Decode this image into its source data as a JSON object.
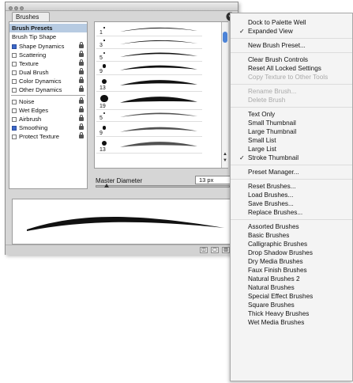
{
  "palette": {
    "tab_label": "Brushes",
    "options": [
      {
        "label": "Brush Presets",
        "selected": true,
        "checkbox": false,
        "checked": false,
        "lock": false
      },
      {
        "label": "Brush Tip Shape",
        "selected": false,
        "checkbox": false,
        "checked": false,
        "lock": false
      },
      {
        "label": "Shape Dynamics",
        "selected": false,
        "checkbox": true,
        "checked": true,
        "lock": true
      },
      {
        "label": "Scattering",
        "selected": false,
        "checkbox": true,
        "checked": false,
        "lock": true
      },
      {
        "label": "Texture",
        "selected": false,
        "checkbox": true,
        "checked": false,
        "lock": true
      },
      {
        "label": "Dual Brush",
        "selected": false,
        "checkbox": true,
        "checked": false,
        "lock": true
      },
      {
        "label": "Color Dynamics",
        "selected": false,
        "checkbox": true,
        "checked": false,
        "lock": true
      },
      {
        "label": "Other Dynamics",
        "selected": false,
        "checkbox": true,
        "checked": false,
        "lock": true
      },
      {
        "label": "Noise",
        "selected": false,
        "checkbox": true,
        "checked": false,
        "lock": true
      },
      {
        "label": "Wet Edges",
        "selected": false,
        "checkbox": true,
        "checked": false,
        "lock": true
      },
      {
        "label": "Airbrush",
        "selected": false,
        "checkbox": true,
        "checked": false,
        "lock": true
      },
      {
        "label": "Smoothing",
        "selected": false,
        "checkbox": true,
        "checked": true,
        "lock": true
      },
      {
        "label": "Protect Texture",
        "selected": false,
        "checkbox": true,
        "checked": false,
        "lock": true
      }
    ],
    "brush_sizes": [
      "1",
      "3",
      "5",
      "9",
      "13",
      "19",
      "5",
      "9",
      "13"
    ],
    "master_diameter_label": "Master Diameter",
    "master_diameter_value": "13 px",
    "master_diameter_slider_level": 0.08
  },
  "menu": {
    "groups": [
      [
        {
          "label": "Dock to Palette Well",
          "checked": false,
          "disabled": false
        },
        {
          "label": "Expanded View",
          "checked": true,
          "disabled": false
        }
      ],
      [
        {
          "label": "New Brush Preset...",
          "checked": false,
          "disabled": false
        }
      ],
      [
        {
          "label": "Clear Brush Controls",
          "checked": false,
          "disabled": false
        },
        {
          "label": "Reset All Locked Settings",
          "checked": false,
          "disabled": false
        },
        {
          "label": "Copy Texture to Other Tools",
          "checked": false,
          "disabled": true
        }
      ],
      [
        {
          "label": "Rename Brush...",
          "checked": false,
          "disabled": true
        },
        {
          "label": "Delete Brush",
          "checked": false,
          "disabled": true
        }
      ],
      [
        {
          "label": "Text Only",
          "checked": false,
          "disabled": false
        },
        {
          "label": "Small Thumbnail",
          "checked": false,
          "disabled": false
        },
        {
          "label": "Large Thumbnail",
          "checked": false,
          "disabled": false
        },
        {
          "label": "Small List",
          "checked": false,
          "disabled": false
        },
        {
          "label": "Large List",
          "checked": false,
          "disabled": false
        },
        {
          "label": "Stroke Thumbnail",
          "checked": true,
          "disabled": false
        }
      ],
      [
        {
          "label": "Preset Manager...",
          "checked": false,
          "disabled": false
        }
      ],
      [
        {
          "label": "Reset Brushes...",
          "checked": false,
          "disabled": false
        },
        {
          "label": "Load Brushes...",
          "checked": false,
          "disabled": false
        },
        {
          "label": "Save Brushes...",
          "checked": false,
          "disabled": false
        },
        {
          "label": "Replace Brushes...",
          "checked": false,
          "disabled": false
        }
      ],
      [
        {
          "label": "Assorted Brushes",
          "checked": false,
          "disabled": false
        },
        {
          "label": "Basic Brushes",
          "checked": false,
          "disabled": false
        },
        {
          "label": "Calligraphic Brushes",
          "checked": false,
          "disabled": false
        },
        {
          "label": "Drop Shadow Brushes",
          "checked": false,
          "disabled": false
        },
        {
          "label": "Dry Media Brushes",
          "checked": false,
          "disabled": false
        },
        {
          "label": "Faux Finish Brushes",
          "checked": false,
          "disabled": false
        },
        {
          "label": "Natural Brushes 2",
          "checked": false,
          "disabled": false
        },
        {
          "label": "Natural Brushes",
          "checked": false,
          "disabled": false
        },
        {
          "label": "Special Effect Brushes",
          "checked": false,
          "disabled": false
        },
        {
          "label": "Square Brushes",
          "checked": false,
          "disabled": false
        },
        {
          "label": "Thick Heavy Brushes",
          "checked": false,
          "disabled": false
        },
        {
          "label": "Wet Media Brushes",
          "checked": false,
          "disabled": false
        }
      ]
    ]
  }
}
